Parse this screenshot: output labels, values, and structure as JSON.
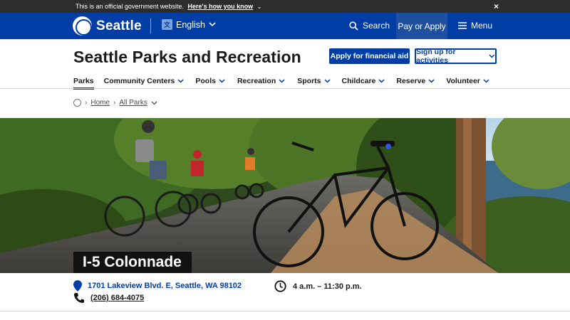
{
  "gov_banner": {
    "text": "This is an official government website.",
    "link": "Here's how you know",
    "close_symbol": "×"
  },
  "header": {
    "logo_text": "Seattle",
    "language": "English",
    "search_label": "Search",
    "pay_label": "Pay or Apply",
    "menu_label": "Menu"
  },
  "title_bar": {
    "site_title": "Seattle Parks and Recreation",
    "aid_button": "Apply for financial aid",
    "signup_button": "Sign up for activities"
  },
  "subnav": {
    "items": [
      {
        "label": "Parks"
      },
      {
        "label": "Community Centers"
      },
      {
        "label": "Pools"
      },
      {
        "label": "Recreation"
      },
      {
        "label": "Sports"
      },
      {
        "label": "Childcare"
      },
      {
        "label": "Reserve"
      },
      {
        "label": "Volunteer"
      }
    ]
  },
  "breadcrumb": {
    "home": "Home",
    "all_parks": "All Parks"
  },
  "hero": {
    "title": "I-5 Colonnade"
  },
  "info": {
    "address": "1701 Lakeview Blvd. E, Seattle, WA 98102",
    "phone": "(206) 684-4075",
    "hours": "4 a.m. – 11:30 p.m."
  },
  "colors": {
    "brand_blue": "#003da5",
    "banner_dark": "#2d2d2d",
    "title_black": "#111111"
  },
  "icons": [
    "seal-logo-icon",
    "translate-icon",
    "search-icon",
    "hamburger-icon",
    "chevron-down-icon",
    "globe-icon",
    "map-pin-icon",
    "phone-icon",
    "clock-icon",
    "close-icon"
  ]
}
